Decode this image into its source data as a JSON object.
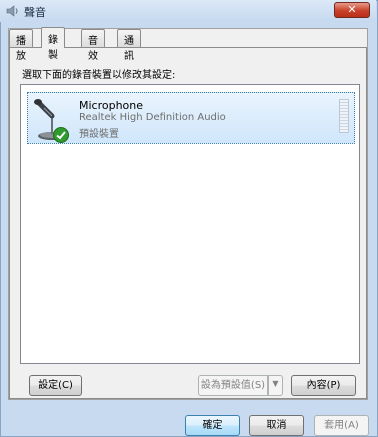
{
  "window": {
    "title": "聲音",
    "close_label": "✕"
  },
  "tabs": [
    {
      "label": "播放"
    },
    {
      "label": "錄製"
    },
    {
      "label": "音效"
    },
    {
      "label": "通訊"
    }
  ],
  "active_tab": 1,
  "panel": {
    "instruction": "選取下面的錄音裝置以修改其設定:"
  },
  "device": {
    "name": "Microphone",
    "driver": "Realtek High Definition Audio",
    "status": "預設裝置",
    "icon": "microphone-icon",
    "badge_icon": "default-check-icon"
  },
  "buttons": {
    "configure": "設定(C)",
    "set_default": "設為預設值(S)",
    "set_default_arrow": "▼",
    "properties": "內容(P)",
    "ok": "確定",
    "cancel": "取消",
    "apply": "套用(A)"
  },
  "colors": {
    "selection": "#cfe6fb",
    "selection_border": "#3c7fb1",
    "close_red": "#c8402a"
  }
}
